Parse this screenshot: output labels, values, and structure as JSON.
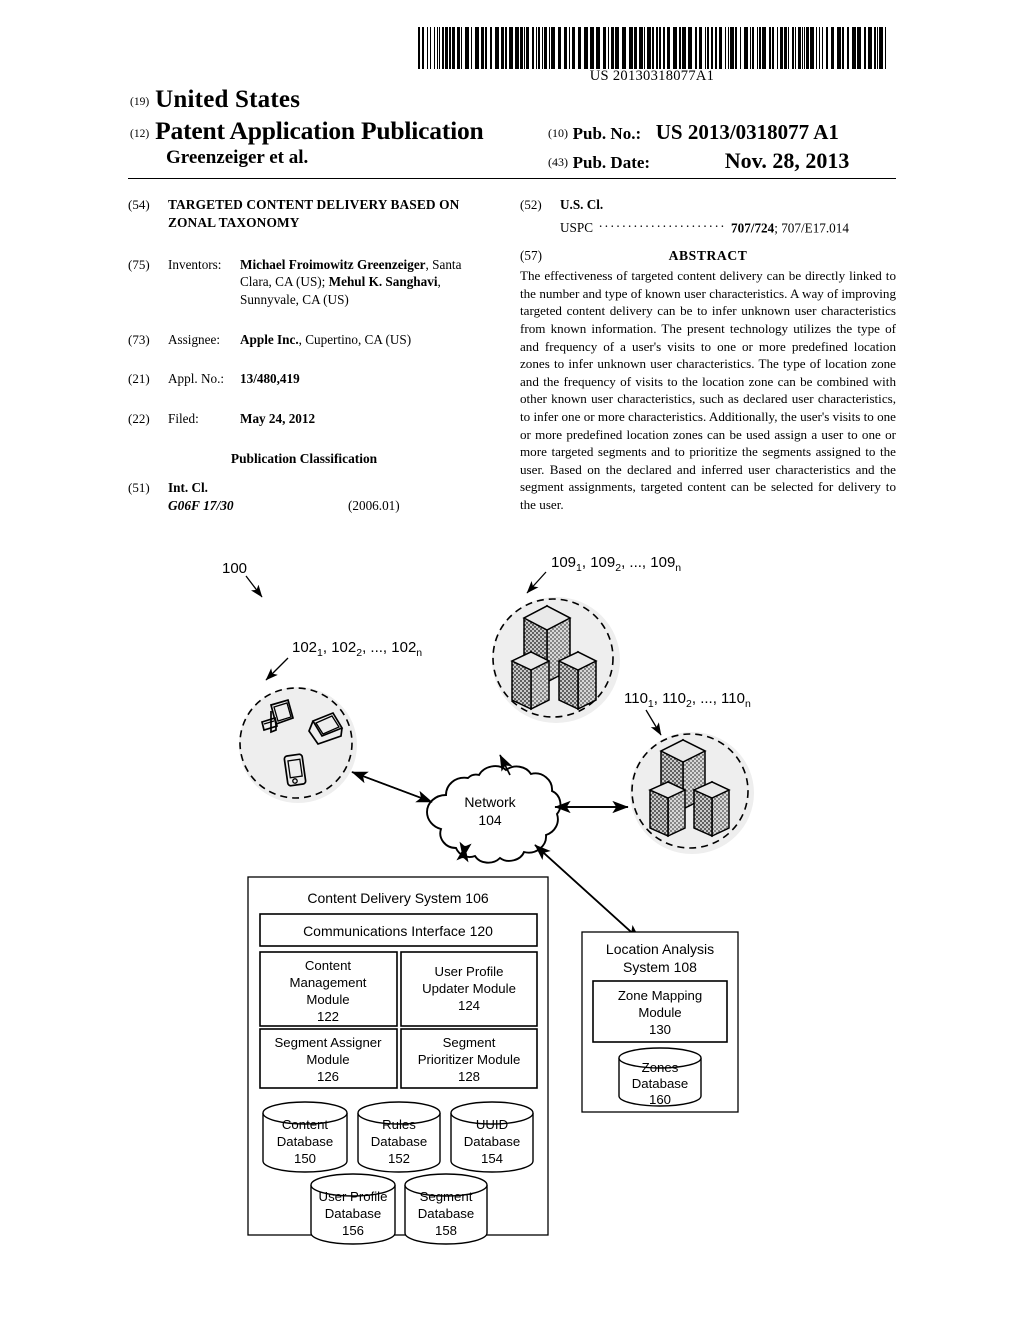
{
  "header": {
    "barcode_number": "US 20130318077A1",
    "code_19": "(19)",
    "country": "United States",
    "code_12": "(12)",
    "doc_type": "Patent Application Publication",
    "authors": "Greenzeiger et al.",
    "code_10": "(10)",
    "pubno_label": "Pub. No.:",
    "pubno_value": "US 2013/0318077 A1",
    "code_43": "(43)",
    "pubdate_label": "Pub. Date:",
    "pubdate_value": "Nov. 28, 2013"
  },
  "biblio": {
    "title_code": "(54)",
    "title": "TARGETED CONTENT DELIVERY BASED ON ZONAL TAXONOMY",
    "inventors_code": "(75)",
    "inventors_label": "Inventors:",
    "inventor1_name": "Michael Froimowitz Greenzeiger",
    "inventor1_loc": ", Santa Clara, CA (US); ",
    "inventor2_name": "Mehul K. Sanghavi",
    "inventor2_loc": ", Sunnyvale, CA (US)",
    "assignee_code": "(73)",
    "assignee_label": "Assignee:",
    "assignee_name": "Apple Inc.",
    "assignee_loc": ", Cupertino, CA (US)",
    "applno_code": "(21)",
    "applno_label": "Appl. No.:",
    "applno_value": "13/480,419",
    "filed_code": "(22)",
    "filed_label": "Filed:",
    "filed_value": "May 24, 2012",
    "pubclass_heading": "Publication Classification",
    "intcl_code": "(51)",
    "intcl_label": "Int. Cl.",
    "intcl_class": "G06F 17/30",
    "intcl_year": "(2006.01)",
    "uscl_code": "(52)",
    "uscl_label": "U.S. Cl.",
    "uspc_label": "USPC",
    "uspc_dots": "....................................",
    "uspc_value_bold": "707/724",
    "uspc_value_rest": "; 707/E17.014",
    "abstract_code": "(57)",
    "abstract_heading": "ABSTRACT",
    "abstract_text": "The effectiveness of targeted content delivery can be directly linked to the number and type of known user characteristics. A way of improving targeted content delivery can be to infer unknown user characteristics from known information. The present technology utilizes the type of and frequency of a user's visits to one or more predefined location zones to infer unknown user characteristics. The type of location zone and the frequency of visits to the location zone can be combined with other known user characteristics, such as declared user characteristics, to infer one or more characteristics. Additionally, the user's visits to one or more predefined location zones can be used assign a user to one or more targeted segments and to prioritize the segments assigned to the user. Based on the declared and inferred user characteristics and the segment assignments, targeted content can be selected for delivery to the user."
  },
  "figure": {
    "system_ref": "100",
    "devices_ref_parts": [
      "102",
      "1",
      ", 102",
      "2",
      ", ..., 102",
      "n"
    ],
    "zones109_ref_parts": [
      "109",
      "1",
      ", 109",
      "2",
      ", ..., 109",
      "n"
    ],
    "zones110_ref_parts": [
      "110",
      "1",
      ", 110",
      "2",
      ", ..., 110",
      "n"
    ],
    "network": {
      "name": "Network",
      "num": "104"
    },
    "cds": {
      "title": "Content Delivery System 106",
      "comm_interface": "Communications Interface 120",
      "modules": [
        {
          "lines": [
            "Content",
            "Management",
            "Module",
            "122"
          ]
        },
        {
          "lines": [
            "User Profile",
            "Updater Module",
            "124"
          ]
        },
        {
          "lines": [
            "Segment Assigner",
            "Module",
            "126"
          ]
        },
        {
          "lines": [
            "Segment",
            "Prioritizer Module",
            "128"
          ]
        }
      ],
      "databases_row1": [
        {
          "lines": [
            "Content",
            "Database",
            "150"
          ]
        },
        {
          "lines": [
            "Rules",
            "Database",
            "152"
          ]
        },
        {
          "lines": [
            "UUID",
            "Database",
            "154"
          ]
        }
      ],
      "databases_row2": [
        {
          "lines": [
            "User Profile",
            "Database",
            "156"
          ]
        },
        {
          "lines": [
            "Segment",
            "Database",
            "158"
          ]
        }
      ]
    },
    "las": {
      "title_line1": "Location Analysis",
      "title_line2": "System 108",
      "module": {
        "lines": [
          "Zone Mapping",
          "Module",
          "130"
        ]
      },
      "database": {
        "lines": [
          "Zones",
          "Database",
          "160"
        ]
      }
    },
    "device_icons": [
      "desktop-computer-icon",
      "laptop-icon",
      "mobile-phone-icon"
    ]
  }
}
